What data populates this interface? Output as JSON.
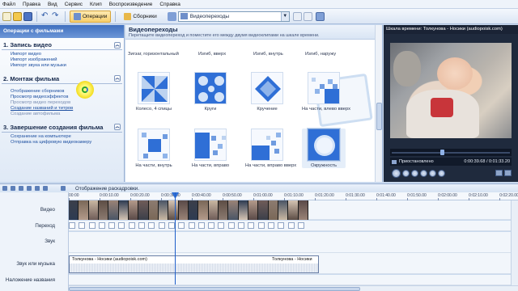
{
  "menu": [
    "Файл",
    "Правка",
    "Вид",
    "Сервис",
    "Клип",
    "Воспроизведение",
    "Справка"
  ],
  "toolbar": {
    "operations_label": "Операции",
    "collections_label": "Сборники",
    "combo_value": "Видеопереходы"
  },
  "taskpane": {
    "header": "Операции с фильмами",
    "sections": [
      {
        "title": "1. Запись видео",
        "links": [
          {
            "label": "Импорт видео",
            "state": "normal"
          },
          {
            "label": "Импорт изображений",
            "state": "normal"
          },
          {
            "label": "Импорт звука или музыки",
            "state": "normal"
          }
        ]
      },
      {
        "title": "2. Монтаж фильма",
        "links": [
          {
            "label": "Отображение сборников",
            "state": "normal"
          },
          {
            "label": "Просмотр видеоэффектов",
            "state": "normal"
          },
          {
            "label": "Просмотр видео переходов",
            "state": "dim"
          },
          {
            "label": "Создание названий и титров",
            "state": "hl"
          },
          {
            "label": "Создание автофильма",
            "state": "dim"
          }
        ]
      },
      {
        "title": "3. Завершение создания фильма",
        "links": [
          {
            "label": "Сохранение на компьютере",
            "state": "normal"
          },
          {
            "label": "Отправка на цифровую видеокамеру",
            "state": "normal"
          }
        ]
      }
    ]
  },
  "gallery": {
    "title": "Видеопереходы",
    "description": "Перетащите видеопереход и поместите его между двумя видеоклипами на шкале времени.",
    "top_row": [
      "Зигзаг, горизонтальный",
      "Изгиб, вверх",
      "Изгиб, внутрь",
      "Изгиб, наружу"
    ],
    "tiles": [
      {
        "label": "Колесо, 4 спицы",
        "icon": "pinwheel-icon"
      },
      {
        "label": "Круги",
        "icon": "circles-icon"
      },
      {
        "label": "Кручение",
        "icon": "twist-icon"
      },
      {
        "label": "На части, влево вверх",
        "icon": "shatter-left-up-icon"
      },
      {
        "label": "На части, внутрь",
        "icon": "shatter-in-icon"
      },
      {
        "label": "На части, вправо",
        "icon": "shatter-right-icon"
      },
      {
        "label": "На части, вправо вверх",
        "icon": "shatter-right-up-icon"
      },
      {
        "label": "Окружность",
        "icon": "circle-icon"
      }
    ]
  },
  "preview": {
    "title": "Шкала времени: Толкунова - Носики  (audiopoisk.com)",
    "status": "Приостановлено",
    "time": "0:00:39.68 / 0:01:33.20",
    "seek_fraction": 0.43
  },
  "timeline": {
    "mode_label": "Отображение раскадровки.",
    "ruler": [
      "00:00",
      "0:00:10.00",
      "0:00:20.00",
      "0:00:30.00",
      "0:00:40.00",
      "0:00:50.00",
      "0:01:00.00",
      "0:01:10.00",
      "0:01:20.00",
      "0:01:30.00",
      "0:01:40.00",
      "0:01:50.00",
      "0:02:00.00",
      "0:02:10.00",
      "0:02:20.00"
    ],
    "tracks": {
      "video": "Видео",
      "transition": "Переход",
      "audio": "Звук",
      "music": "Звук или музыка",
      "title": "Наложение названия"
    },
    "music_clip_a": "Толкунова - Носики  (audiopoisk.com)",
    "music_clip_b": "Толкунова - Носики"
  }
}
